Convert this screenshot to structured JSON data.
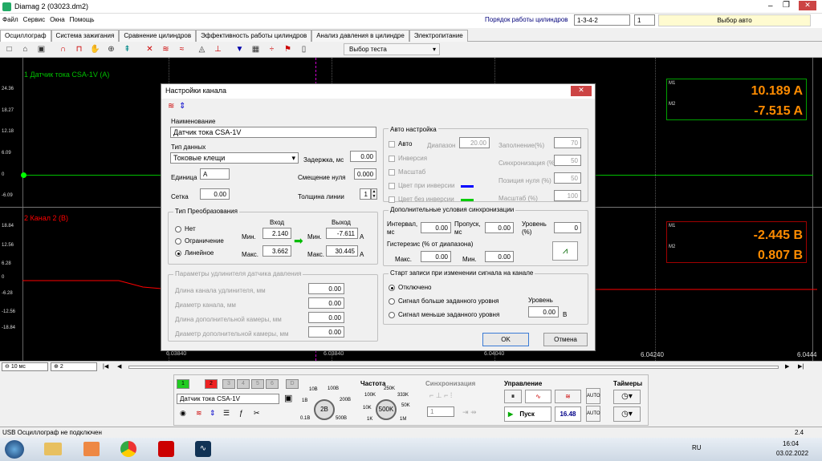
{
  "window": {
    "title": "Diamag 2 (03023.dm2)"
  },
  "menu": [
    "Файл",
    "Сервис",
    "Окна",
    "Помощь"
  ],
  "header": {
    "cyl_order_label": "Порядок работы цилиндров",
    "cyl_order_value": "1-3-4-2",
    "cyl_num": "1",
    "auto_select": "Выбор авто"
  },
  "tabs": [
    "Осциллограф",
    "Система зажигания",
    "Сравнение цилиндров",
    "Эффективность работы цилиндров",
    "Анализ давления в цилиндре",
    "Электропитание"
  ],
  "toolbar": {
    "test_select": "Выбор теста"
  },
  "scope": {
    "ch1": {
      "title": "1 Датчик тока CSA-1V (A)",
      "ticks": [
        "24.36",
        "18.27",
        "12.18",
        "6.09",
        "0",
        "-6.09"
      ],
      "m1_label": "M1",
      "m2_label": "M2",
      "m1": "10.189 A",
      "m2": "-7.515 A"
    },
    "ch2": {
      "title": "2 Канал 2 (В)",
      "ticks": [
        "18.84",
        "12.56",
        "6.28",
        "0",
        "-6.28",
        "-12.56",
        "-18.84"
      ],
      "m1_label": "M1",
      "m2_label": "M2",
      "m1": "-2.445 В",
      "m2": "0.807 В"
    },
    "time_ticks": [
      "6.03840",
      "6.03840",
      "6.04040",
      "6.04240",
      "6.0444"
    ]
  },
  "dialog": {
    "title": "Настройки канала",
    "name_label": "Наименование",
    "name_value": "Датчик тока CSA-1V",
    "type_label": "Тип данных",
    "type_value": "Токовые клещи",
    "delay_label": "Задержка, мс",
    "delay_value": "0.00",
    "unit_label": "Единица",
    "unit_value": "A",
    "offset_label": "Смещение нуля",
    "offset_value": "0.000",
    "grid_label": "Сетка",
    "grid_value": "0.00",
    "thick_label": "Толщина линии",
    "thick_value": "1",
    "conv": {
      "title": "Тип Преобразования",
      "options": [
        "Нет",
        "Ограничение",
        "Линейное"
      ],
      "in_label": "Вход",
      "out_label": "Выход",
      "min_label": "Мин.",
      "max_label": "Макс.",
      "in_min": "2.140",
      "in_max": "3.662",
      "out_min": "-7.611",
      "out_max": "30.445",
      "unit": "A"
    },
    "ext": {
      "title": "Параметры удлинителя датчика давления",
      "rows": [
        {
          "label": "Длина канала удлинителя, мм",
          "value": "0.00"
        },
        {
          "label": "Диаметр канала, мм",
          "value": "0.00"
        },
        {
          "label": "Длина дополнительной камеры, мм",
          "value": "0.00"
        },
        {
          "label": "Диаметр дополнительной камеры, мм",
          "value": "0.00"
        }
      ]
    },
    "auto": {
      "title": "Авто настройка",
      "auto": "Авто",
      "range_label": "Диапазон",
      "range_value": "20.00",
      "inverse": "Инверсия",
      "scale": "Масштаб",
      "color_inv": "Цвет при инверсии",
      "color_noinv": "Цвет без инверсии",
      "fill_label": "Заполнение(%)",
      "fill_value": "70",
      "sync_label": "Синхронизация (%)",
      "sync_value": "50",
      "zero_label": "Позиция нуля (%)",
      "zero_value": "50",
      "scale_label": "Масштаб (%)",
      "scale_value": "100"
    },
    "sync": {
      "title": "Дополнительные условия синхронизации",
      "interval_label": "Интервал, мс",
      "interval_value": "0.00",
      "skip_label": "Пропуск, мс",
      "skip_value": "0.00",
      "level_label": "Уровень (%)",
      "level_value": "0",
      "hyst_label": "Гистерезис (% от диапазона)",
      "max_label": "Макс.",
      "max_value": "0.00",
      "min_label": "Мин.",
      "min_value": "0.00"
    },
    "rec": {
      "title": "Старт записи при изменении сигнала на канале",
      "options": [
        "Отключено",
        "Сигнал больше заданного уровня",
        "Сигнал меньше заданного уровня"
      ],
      "level_label": "Уровень",
      "level_value": "0.00",
      "level_unit": "В"
    },
    "ok": "OK",
    "cancel": "Отмена"
  },
  "timeline": {
    "zoom": "10 мс",
    "ch": "2"
  },
  "controls": {
    "channels": [
      "1",
      "2",
      "3",
      "4",
      "5",
      "6",
      "D"
    ],
    "channel_name": "Датчик тока CSA-1V",
    "range_labels": [
      "10В",
      "100В",
      "1В",
      "200В",
      "0.1В",
      "500В"
    ],
    "range_value": "2В",
    "freq_title": "Частота",
    "freq_labels": [
      "250K",
      "100K",
      "333K",
      "10K",
      "50K",
      "1K",
      "1M"
    ],
    "freq_value": "500K",
    "sync_title": "Синхронизация",
    "sync_value": "1",
    "ctrl_title": "Управление",
    "start_label": "Пуск",
    "counter": "16.48",
    "timers_title": "Таймеры"
  },
  "status": {
    "left": "USB Осциллограф не подключен",
    "right": "2.4"
  },
  "taskbar": {
    "lang": "RU",
    "time": "16:04",
    "date": "03.02.2022"
  },
  "colors": {
    "ch1": "#00c000",
    "ch2": "#ff2020",
    "readout": "#ff8c00"
  }
}
